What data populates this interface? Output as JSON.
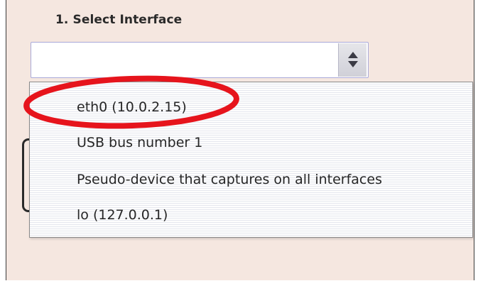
{
  "section": {
    "title": "1. Select Interface"
  },
  "select": {
    "value": ""
  },
  "dropdown": {
    "options": [
      {
        "label": "eth0  (10.0.2.15)"
      },
      {
        "label": "USB bus number 1"
      },
      {
        "label": "Pseudo-device that captures on all interfaces"
      },
      {
        "label": "lo  (127.0.0.1)"
      }
    ]
  },
  "colors": {
    "panel_background": "#f5e7e0",
    "annotation_circle": "#e6141c",
    "select_border": "#a9a9d9"
  },
  "icons": {
    "select_arrows": "up-down-arrows-icon",
    "highlight": "red-ellipse-annotation"
  }
}
